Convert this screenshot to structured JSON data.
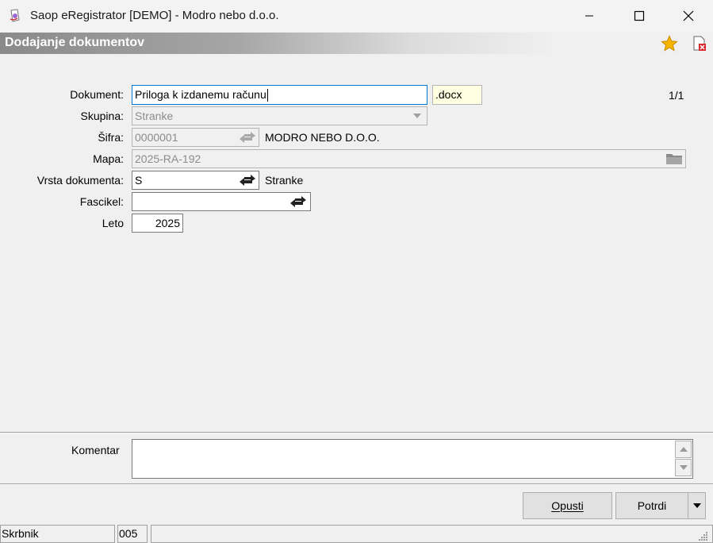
{
  "window": {
    "title": "Saop eRegistrator [DEMO] - Modro nebo d.o.o."
  },
  "header": {
    "title": "Dodajanje dokumentov"
  },
  "form": {
    "dokument": {
      "label": "Dokument:",
      "value": "Priloga k izdanemu računu",
      "extension": ".docx",
      "pager": "1/1"
    },
    "skupina": {
      "label": "Skupina:",
      "value": "Stranke"
    },
    "sifra": {
      "label": "Šifra:",
      "value": "0000001",
      "name": "MODRO NEBO D.O.O."
    },
    "mapa": {
      "label": "Mapa:",
      "value": "2025-RA-192"
    },
    "vrsta": {
      "label": "Vrsta dokumenta:",
      "value": "S",
      "name": "Stranke"
    },
    "fascikel": {
      "label": "Fascikel:",
      "value": ""
    },
    "leto": {
      "label": "Leto",
      "value": "2025"
    }
  },
  "comment": {
    "label": "Komentar",
    "value": ""
  },
  "buttons": {
    "cancel": "Opusti",
    "confirm": "Potrdi"
  },
  "status": {
    "user": "Skrbnik",
    "code": "005",
    "extra": ""
  },
  "colors": {
    "focus": "#0078d7",
    "extension_bg": "#ffffe1",
    "star": "#f5b400",
    "header_band": "#8a8a8a"
  }
}
